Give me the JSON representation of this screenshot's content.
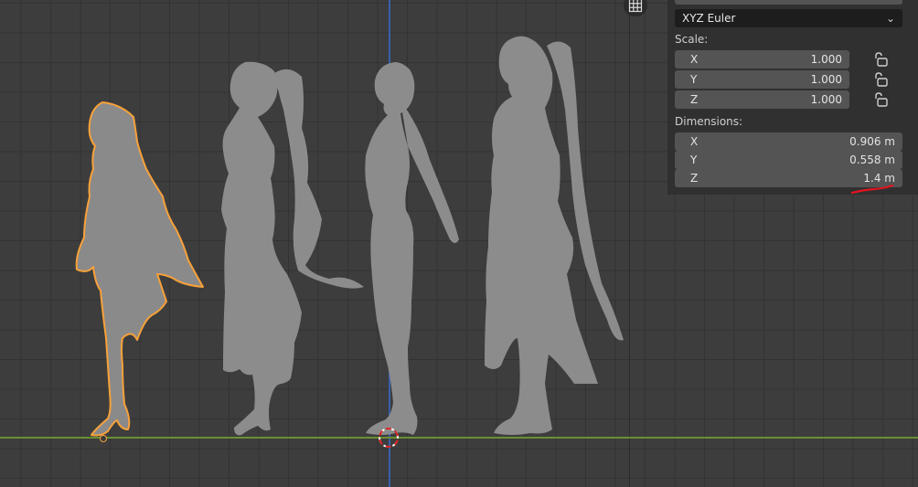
{
  "rotation_mode": {
    "value": "XYZ Euler",
    "icon": "chevron-down-icon"
  },
  "scale": {
    "label": "Scale:",
    "x": {
      "axis": "X",
      "value": "1.000"
    },
    "y": {
      "axis": "Y",
      "value": "1.000"
    },
    "z": {
      "axis": "Z",
      "value": "1.000"
    }
  },
  "dimensions": {
    "label": "Dimensions:",
    "x": {
      "axis": "X",
      "value": "0.906 m"
    },
    "y": {
      "axis": "Y",
      "value": "0.558 m"
    },
    "z": {
      "axis": "Z",
      "value": "1.4 m"
    }
  },
  "colors": {
    "viewport_bg": "#3d3d3d",
    "grid": "#333333",
    "axis_z": "#3a5fa8",
    "axis_y": "#6b8f2f",
    "selection_outline": "#f7a13a",
    "model": "#8f8f8f",
    "panel_bg": "#303030",
    "field_bg": "#545454",
    "annotation": "#e0141e"
  },
  "icons": [
    "grid-toggle-icon",
    "lock-icon",
    "3d-cursor-icon",
    "origin-dot-icon"
  ]
}
